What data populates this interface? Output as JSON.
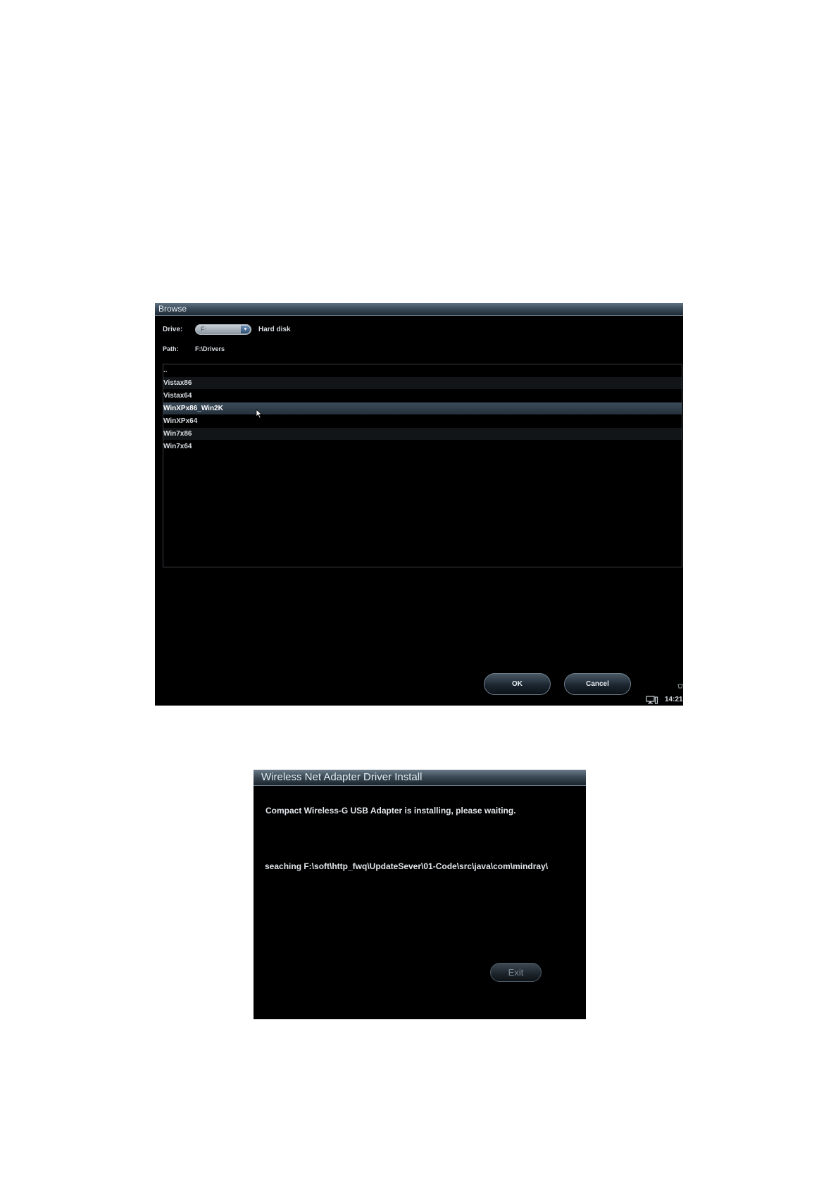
{
  "browse": {
    "title": "Browse",
    "drive_label": "Drive:",
    "drive_value": "F:",
    "drive_type": "Hard disk",
    "path_label": "Path:",
    "path_value": "F:\\Drivers",
    "items": [
      "..",
      "Vistax86",
      "Vistax64",
      "WinXPx86_Win2K",
      "WinXPx64",
      "Win7x86",
      "Win7x64"
    ],
    "selected_item": "WinXPx86_Win2K",
    "ok_label": "OK",
    "cancel_label": "Cancel",
    "clock": "14:21"
  },
  "install": {
    "title": "Wireless Net Adapter Driver Install",
    "status_message": "Compact Wireless-G USB Adapter  is installing, please waiting.",
    "search_message": "seaching F:\\soft\\http_fwq\\UpdateSever\\01-Code\\src\\java\\com\\mindray\\",
    "exit_label": "Exit"
  },
  "colors": {
    "window_background": "#000000",
    "title_bar": "#3b4c5a",
    "selected_row": "#34444f",
    "text": "#d8dde2"
  },
  "icons": [
    "dropdown-arrow-icon",
    "mouse-cursor-icon",
    "monitor-icon"
  ]
}
